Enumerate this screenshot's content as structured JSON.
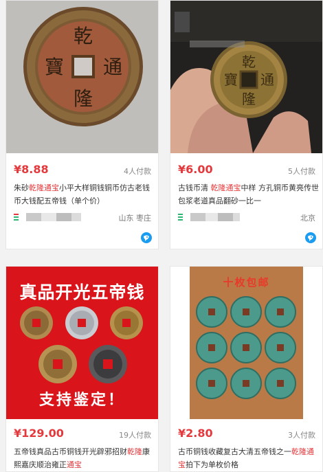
{
  "products": [
    {
      "price": "¥8.88",
      "sold": "4人付款",
      "title_segments": [
        {
          "text": "朱砂",
          "hl": false
        },
        {
          "text": "乾隆通宝",
          "hl": true
        },
        {
          "text": "小平大样铜钱铜币仿古老钱币大钱配五帝钱（单个价）",
          "hl": false
        }
      ],
      "location": "山东 枣庄",
      "coin_chars": [
        "乾",
        "隆",
        "寶",
        "通"
      ]
    },
    {
      "price": "¥6.00",
      "sold": "5人付款",
      "title_segments": [
        {
          "text": "古钱币清 ",
          "hl": false
        },
        {
          "text": "乾隆通宝",
          "hl": true
        },
        {
          "text": "中样 方孔铜币黄亮传世包浆老道真品翻砂一比一",
          "hl": false
        }
      ],
      "location": "北京",
      "coin_chars": [
        "乾",
        "隆",
        "寶",
        "通"
      ]
    },
    {
      "price": "¥129.00",
      "sold": "19人付款",
      "title_segments": [
        {
          "text": "五帝钱真品古币铜钱开光辟邪招财",
          "hl": false
        },
        {
          "text": "乾隆",
          "hl": true
        },
        {
          "text": "康熙嘉庆顺治雍正",
          "hl": false
        },
        {
          "text": "通宝",
          "hl": true
        }
      ],
      "banner_top": "真品开光五帝钱",
      "banner_bottom": "支持鉴定！"
    },
    {
      "price": "¥2.80",
      "sold": "3人付款",
      "title_segments": [
        {
          "text": "古币铜钱收藏复古大清五帝钱之一",
          "hl": false
        },
        {
          "text": "乾隆通宝",
          "hl": true
        },
        {
          "text": "拍下为单枚价格",
          "hl": false
        }
      ],
      "panel_text": "十枚包邮"
    }
  ],
  "colors": {
    "accent": "#e4393c",
    "banner": "#d9141b"
  }
}
